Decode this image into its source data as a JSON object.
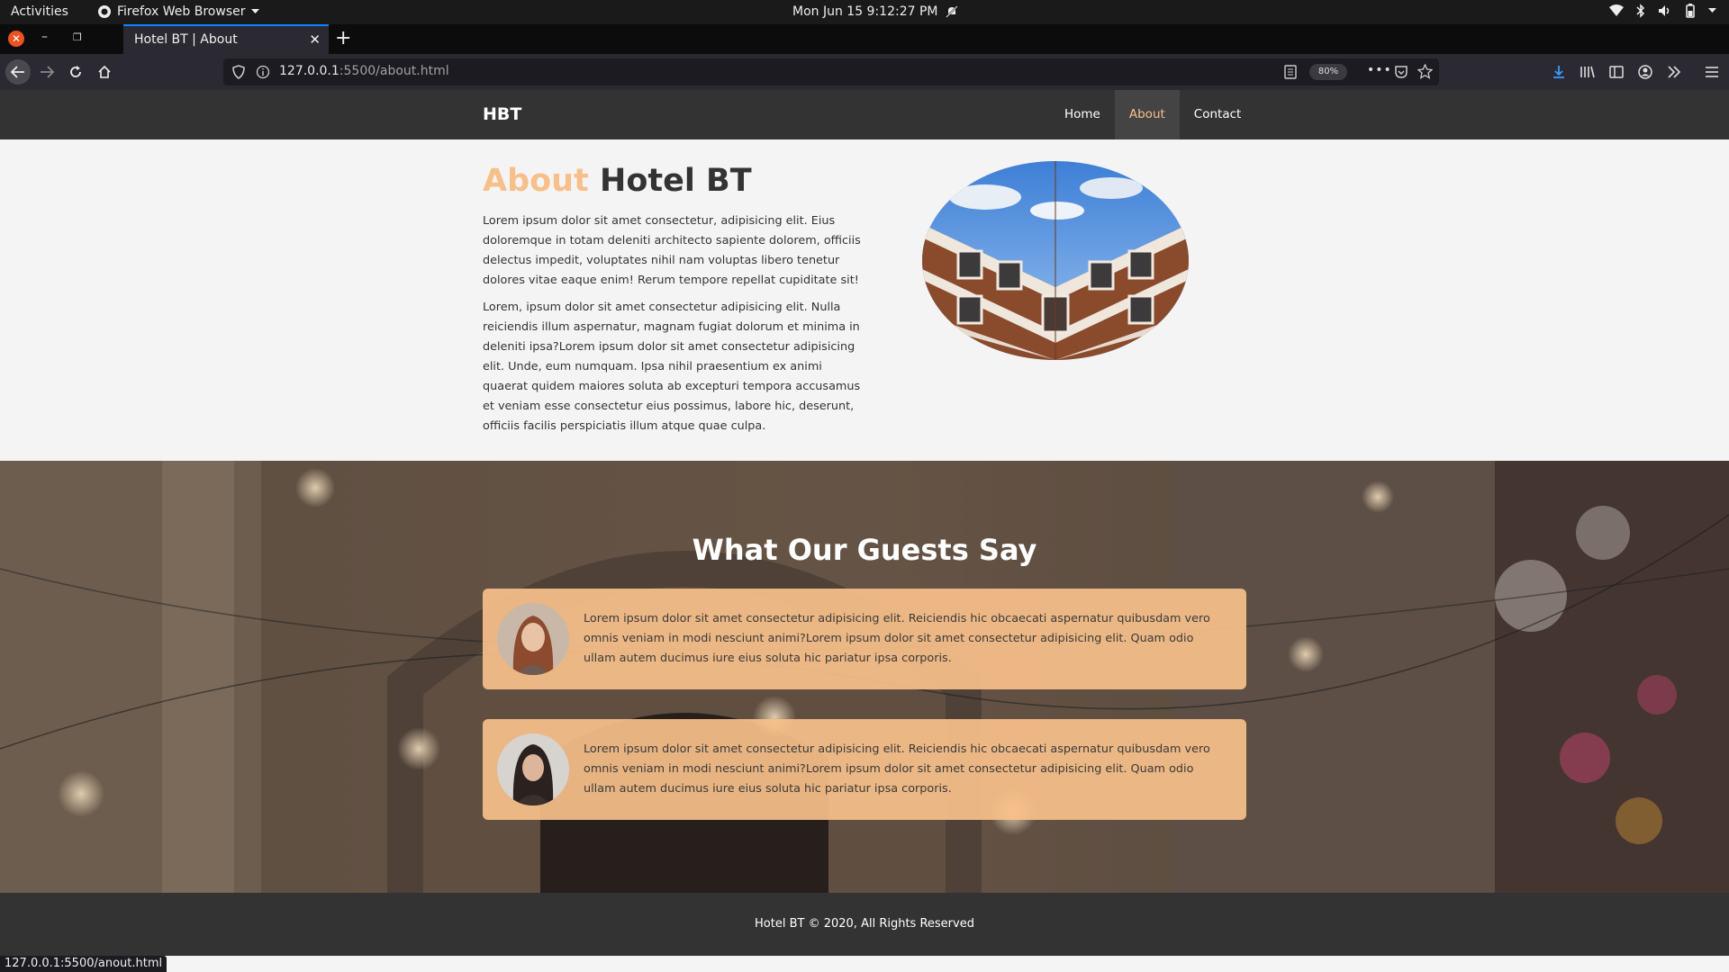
{
  "system_bar": {
    "activities": "Activities",
    "app_name": "Firefox Web Browser",
    "clock": "Mon Jun 15  9:12:27 PM"
  },
  "browser": {
    "tab_title": "Hotel BT | About",
    "url_host": "127.0.0.1",
    "url_rest": ":5500/about.html",
    "zoom": "80%",
    "status_link": "127.0.0.1:5500/anout.html"
  },
  "site": {
    "brand": "HBT",
    "nav": [
      {
        "label": "Home",
        "current": false
      },
      {
        "label": "About",
        "current": true
      },
      {
        "label": "Contact",
        "current": false
      }
    ],
    "accent_color": "#f7c08a"
  },
  "about": {
    "title_accent": "About",
    "title_rest": " Hotel BT",
    "para1": "Lorem ipsum dolor sit amet consectetur, adipisicing elit. Eius doloremque in totam deleniti architecto sapiente dolorem, officiis delectus impedit, voluptates nihil nam voluptas libero tenetur dolores vitae eaque enim! Rerum tempore repellat cupiditate sit!",
    "para2": "Lorem, ipsum dolor sit amet consectetur adipisicing elit. Nulla reiciendis illum aspernatur, magnam fugiat dolorum et minima in deleniti ipsa?Lorem ipsum dolor sit amet consectetur adipisicing elit. Unde, eum numquam. Ipsa nihil praesentium ex animi quaerat quidem maiores soluta ab excepturi tempora accusamus et veniam esse consectetur eius possimus, labore hic, deserunt, officiis facilis perspiciatis illum atque quae culpa."
  },
  "testimonials": {
    "title": "What Our Guests Say",
    "items": [
      {
        "text": "Lorem ipsum dolor sit amet consectetur adipisicing elit. Reiciendis hic obcaecati aspernatur quibusdam vero omnis veniam in modi nesciunt animi?Lorem ipsum dolor sit amet consectetur adipisicing elit. Quam odio ullam autem ducimus iure eius soluta hic pariatur ipsa corporis."
      },
      {
        "text": "Lorem ipsum dolor sit amet consectetur adipisicing elit. Reiciendis hic obcaecati aspernatur quibusdam vero omnis veniam in modi nesciunt animi?Lorem ipsum dolor sit amet consectetur adipisicing elit. Quam odio ullam autem ducimus iure eius soluta hic pariatur ipsa corporis."
      }
    ]
  },
  "footer": {
    "text": "Hotel BT © 2020, All Rights Reserved"
  }
}
